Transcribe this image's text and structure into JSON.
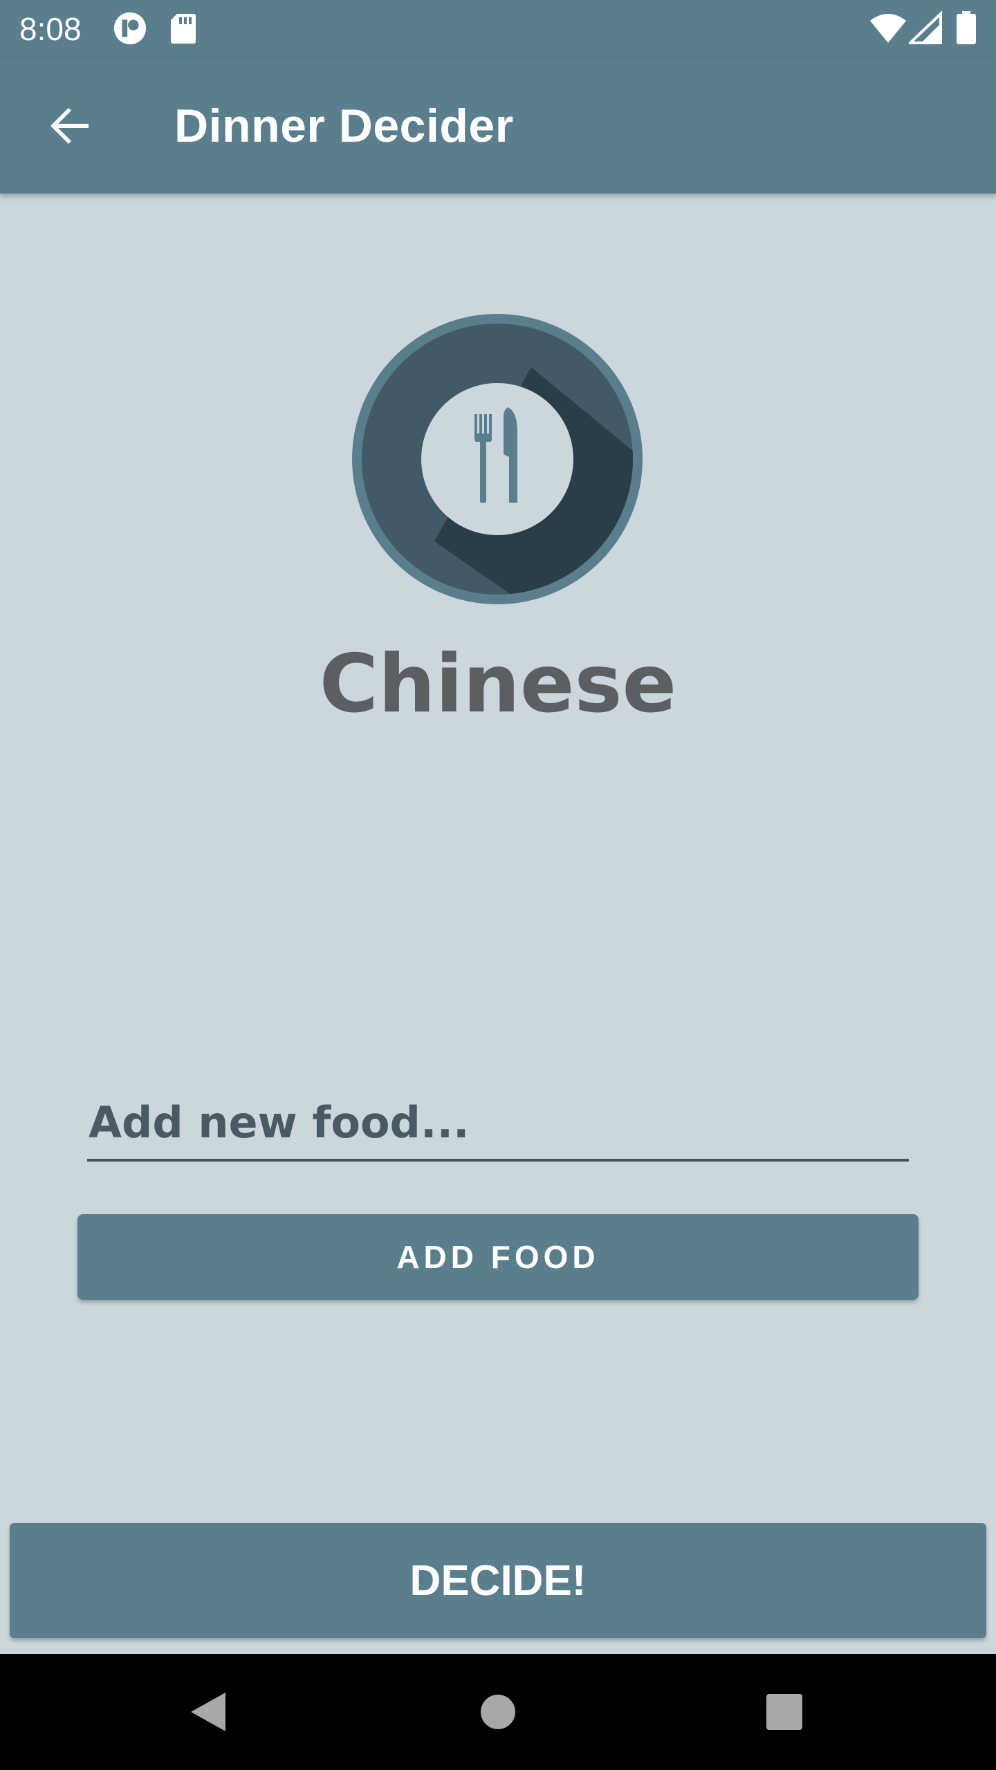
{
  "status_bar": {
    "time": "8:08",
    "icons": [
      "app-notification-icon",
      "sd-card-icon",
      "wifi-icon",
      "signal-icon",
      "battery-icon"
    ]
  },
  "app_bar": {
    "title": "Dinner Decider",
    "back_icon": "arrow-back-icon"
  },
  "main": {
    "logo_icon": "fork-knife-plate-icon",
    "selected_food": "Chinese",
    "input": {
      "placeholder": "Add new food...",
      "value": ""
    },
    "add_food_label": "ADD FOOD",
    "decide_label": "DECIDE!"
  },
  "nav_bar": {
    "icons": [
      "back-triangle-icon",
      "home-circle-icon",
      "recents-square-icon"
    ]
  },
  "colors": {
    "primary": "#5A7E8C",
    "background": "#CCD7DD",
    "text_dark": "#5B5F62",
    "logo_dark": "#425A66",
    "logo_shadow": "#2B3D46"
  }
}
